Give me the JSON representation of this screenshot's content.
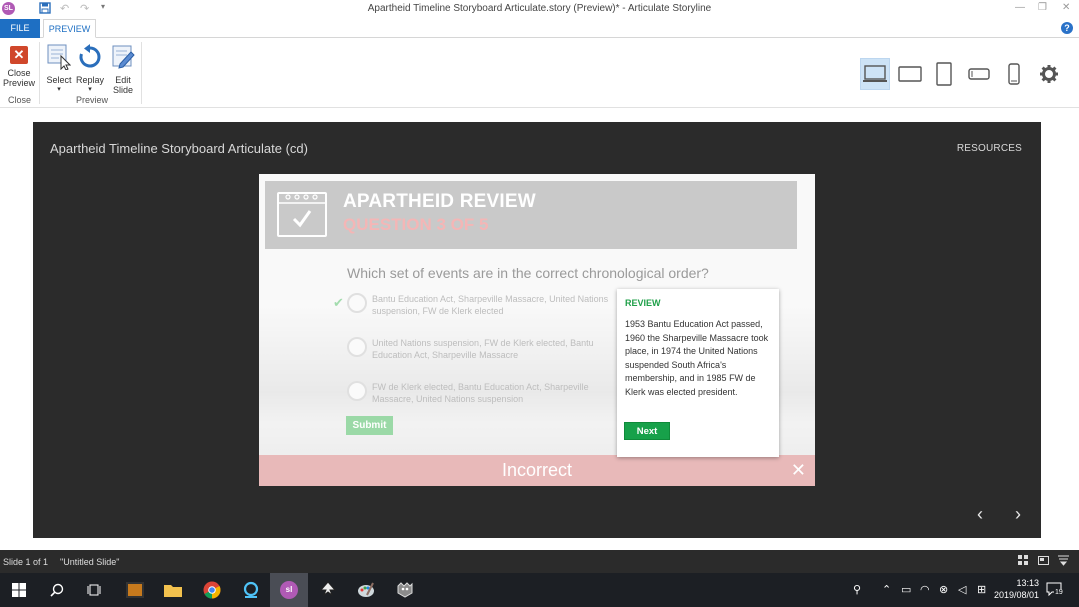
{
  "window": {
    "title": "Apartheid Timeline Storyboard Articulate.story (Preview)* - Articulate Storyline",
    "app_badge": "SL"
  },
  "ribbon": {
    "tabs": [
      "FILE",
      "PREVIEW"
    ],
    "help": "?",
    "groups": [
      {
        "label": "Close",
        "buttons": [
          {
            "label": "Close Preview",
            "icon": "close-icon"
          }
        ]
      },
      {
        "label": "Preview",
        "buttons": [
          {
            "label": "Select",
            "icon": "select-icon"
          },
          {
            "label": "Replay",
            "icon": "replay-icon"
          },
          {
            "label": "Edit Slide",
            "icon": "edit-slide-icon"
          }
        ]
      }
    ],
    "devices": [
      "desktop-icon",
      "tablet-landscape-icon",
      "tablet-portrait-icon",
      "phone-landscape-icon",
      "phone-portrait-icon",
      "gear-icon"
    ]
  },
  "player": {
    "project_title": "Apartheid Timeline Storyboard Articulate (cd)",
    "resources": "RESOURCES",
    "prev": "‹",
    "next": "›"
  },
  "slide": {
    "header_title": "APARTHEID REVIEW",
    "header_sub": "QUESTION 3 OF 5",
    "question": "Which set of events are in the correct chronological order?",
    "options": [
      "Bantu Education Act, Sharpeville Massacre, United Nations suspension, FW de Klerk elected",
      "United Nations suspension, FW de Klerk elected, Bantu Education Act, Sharpeville Massacre",
      "FW de Klerk elected, Bantu Education Act, Sharpeville Massacre, United Nations suspension"
    ],
    "submit": "Submit",
    "feedback": "Incorrect",
    "close": "✕"
  },
  "review": {
    "heading": "REVIEW",
    "body": "1953 Bantu Education Act passed, 1960 the Sharpeville Massacre took place, in 1974 the United Nations suspended South Africa's membership, and in 1985 FW de Klerk was elected president.",
    "next": "Next"
  },
  "statusbar": {
    "slide": "Slide 1 of 1",
    "slide_name": "\"Untitled Slide\""
  },
  "taskbar": {
    "time": "13:13",
    "date": "2019/08/01",
    "notifications": "19",
    "sl_badge": "sl"
  },
  "colors": {
    "accent_blue": "#1e6fc3",
    "correct_green": "#17a14a",
    "incorrect_pink": "#e8b9b9",
    "stage_dark": "#2b2b2b"
  }
}
